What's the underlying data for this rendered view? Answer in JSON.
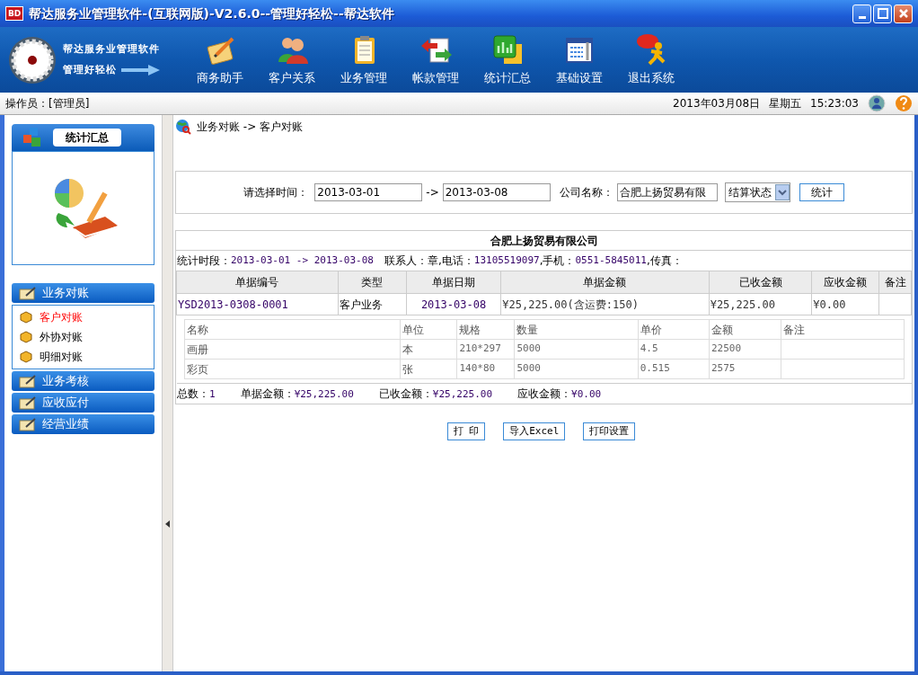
{
  "window": {
    "logo": "BD",
    "title": "帮达服务业管理软件-(互联网版)-V2.6.0--管理好轻松--帮达软件"
  },
  "brand": {
    "name": "帮达服务业管理软件",
    "slogan": "管理好轻松"
  },
  "toolbar": [
    {
      "label": "商务助手"
    },
    {
      "label": "客户关系"
    },
    {
      "label": "业务管理"
    },
    {
      "label": "帐款管理"
    },
    {
      "label": "统计汇总"
    },
    {
      "label": "基础设置"
    },
    {
      "label": "退出系统"
    }
  ],
  "status_bar": {
    "operator": "操作员：[管理员]",
    "date": "2013年03月08日",
    "weekday": "星期五",
    "time": "15:23:03"
  },
  "sidebar": {
    "panel_title": "统计汇总",
    "sections": [
      {
        "label": "业务对账",
        "expanded": true,
        "children": [
          {
            "label": "客户对账",
            "selected": true
          },
          {
            "label": "外协对账",
            "selected": false
          },
          {
            "label": "明细对账",
            "selected": false
          }
        ]
      },
      {
        "label": "业务考核"
      },
      {
        "label": "应收应付"
      },
      {
        "label": "经营业绩"
      }
    ]
  },
  "breadcrumb": "业务对账 -> 客户对账",
  "filter": {
    "time_label": "请选择时间：",
    "date_from": "2013-03-01",
    "separator": "->",
    "date_to": "2013-03-08",
    "company_label": "公司名称：",
    "company": "合肥上扬贸易有限",
    "status_select": "结算状态",
    "submit": "统计"
  },
  "report": {
    "title": "合肥上扬贸易有限公司",
    "info": [
      {
        "label": "统计时段：",
        "value": "2013-03-01 -> 2013-03-08"
      },
      {
        "label": "联系人：章,电话：",
        "value": "13105519097"
      },
      {
        "label": ",手机：",
        "value": "0551-5845011"
      },
      {
        "label": ",传真："
      }
    ],
    "columns": [
      "单据编号",
      "类型",
      "单据日期",
      "单据金额",
      "已收金额",
      "应收金额",
      "备注"
    ],
    "rows": [
      {
        "cells": [
          "YSD2013-0308-0001",
          "客户业务",
          "2013-03-08",
          "¥25,225.00(含运费:150)",
          "¥25,225.00",
          "¥0.00",
          ""
        ],
        "detail": {
          "columns": [
            "名称",
            "单位",
            "规格",
            "数量",
            "单价",
            "金额",
            "备注"
          ],
          "rows": [
            [
              "画册",
              "本",
              "210*297",
              "5000",
              "4.5",
              "22500",
              ""
            ],
            [
              "彩页",
              "张",
              "140*80",
              "5000",
              "0.515",
              "2575",
              ""
            ]
          ]
        }
      }
    ],
    "totals": [
      {
        "label": "总数：",
        "value": "1"
      },
      {
        "label": "单据金额：",
        "value": "¥25,225.00"
      },
      {
        "label": "已收金额：",
        "value": "¥25,225.00"
      },
      {
        "label": "应收金额：",
        "value": "¥0.00"
      }
    ]
  },
  "actions": [
    "打 印",
    "导入Excel",
    "打印设置"
  ]
}
